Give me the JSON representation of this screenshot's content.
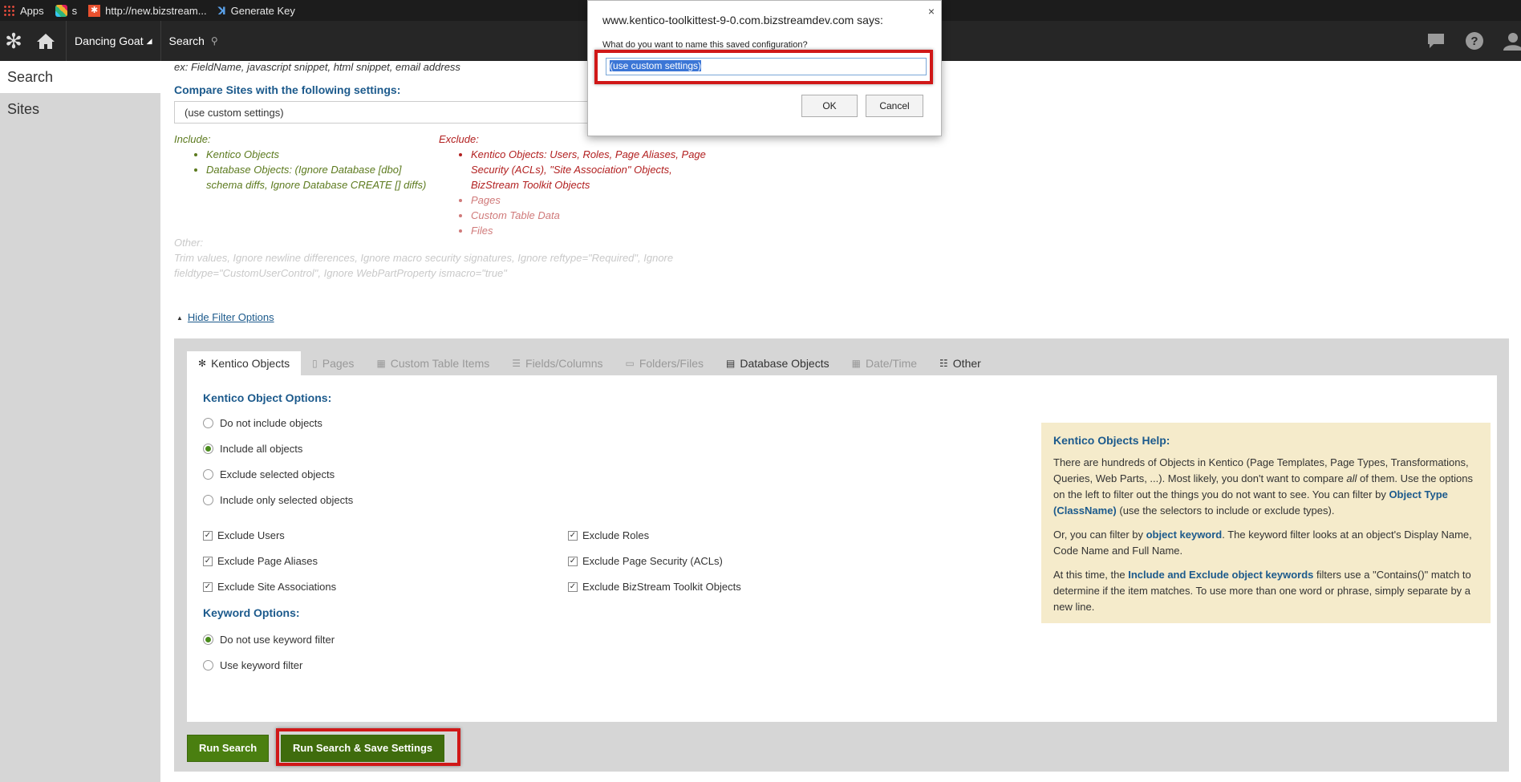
{
  "bookmarks": [
    {
      "icon": "apps-grid-icon",
      "label": "Apps"
    },
    {
      "icon": "slack-icon",
      "label": "s"
    },
    {
      "icon": "bizstream-icon",
      "label": "http://new.bizstream..."
    },
    {
      "icon": "kentico-k-icon",
      "label": "Generate Key"
    }
  ],
  "header": {
    "site": "Dancing Goat",
    "app": "Search"
  },
  "leftnav": {
    "items": [
      {
        "label": "Search",
        "active": true
      },
      {
        "label": "Sites",
        "active": false
      }
    ]
  },
  "main": {
    "hint": "ex: FieldName, javascript snippet, html snippet, email address",
    "compare_label": "Compare Sites with the following settings:",
    "compare_value": "(use custom settings)",
    "include_label": "Include:",
    "include_items": [
      "Kentico Objects",
      "Database Objects: (Ignore Database [dbo] schema diffs, Ignore Database CREATE [] diffs)"
    ],
    "exclude_label": "Exclude:",
    "exclude_items": [
      "Kentico Objects: Users, Roles, Page Aliases, Page Security (ACLs), \"Site Association\" Objects, BizStream Toolkit Objects",
      "Pages",
      "Custom Table Data",
      "Files"
    ],
    "other_label": "Other:",
    "other_text": "Trim values, Ignore newline differences, Ignore macro security signatures, Ignore reftype=\"Required\", Ignore fieldtype=\"CustomUserControl\", Ignore WebPartProperty ismacro=\"true\"",
    "toggle_label": "Hide Filter Options"
  },
  "tabs": [
    {
      "icon": "kentico-icon",
      "label": "Kentico Objects",
      "active": true
    },
    {
      "icon": "page-icon",
      "label": "Pages"
    },
    {
      "icon": "table-icon",
      "label": "Custom Table Items"
    },
    {
      "icon": "list-icon",
      "label": "Fields/Columns"
    },
    {
      "icon": "folder-icon",
      "label": "Folders/Files"
    },
    {
      "icon": "database-icon",
      "label": "Database Objects"
    },
    {
      "icon": "calendar-icon",
      "label": "Date/Time"
    },
    {
      "icon": "list-bullets-icon",
      "label": "Other"
    }
  ],
  "object_options": {
    "title": "Kentico Object Options:",
    "radios": [
      {
        "label": "Do not include objects",
        "checked": false
      },
      {
        "label": "Include all objects",
        "checked": true
      },
      {
        "label": "Exclude selected objects",
        "checked": false
      },
      {
        "label": "Include only selected objects",
        "checked": false
      }
    ],
    "checks": [
      "Exclude Users",
      "Exclude Roles",
      "Exclude Page Aliases",
      "Exclude Page Security (ACLs)",
      "Exclude Site Associations",
      "Exclude BizStream Toolkit Objects"
    ]
  },
  "keyword_options": {
    "title": "Keyword Options:",
    "radios": [
      {
        "label": "Do not use keyword filter",
        "checked": true
      },
      {
        "label": "Use keyword filter",
        "checked": false
      }
    ]
  },
  "help": {
    "title": "Kentico Objects Help:",
    "p1a": "There are hundreds of Objects in Kentico (Page Templates, Page Types, Transformations, Queries, Web Parts, ...). Most likely, you don't want to compare ",
    "p1b": "all",
    "p1c": " of them. Use the options on the left to filter out the things you do not want to see. You can filter by ",
    "p1d": "Object Type (ClassName)",
    "p1e": " (use the selectors to include or exclude types).",
    "p2a": "Or, you can filter by ",
    "p2b": "object keyword",
    "p2c": ". The keyword filter looks at an object's Display Name, Code Name and Full Name.",
    "p3a": "At this time, the ",
    "p3b": "Include and Exclude object keywords",
    "p3c": " filters use a \"Contains()\" match to determine if the item matches. To use more than one word or phrase, simply separate by a new line."
  },
  "buttons": {
    "run": "Run Search",
    "run_save": "Run Search & Save Settings"
  },
  "dialog": {
    "title": "www.kentico-toolkittest-9-0.com.bizstreamdev.com says:",
    "close": "×",
    "message": "What do you want to name this saved configuration?",
    "input_value": "(use custom settings)",
    "ok": "OK",
    "cancel": "Cancel"
  }
}
